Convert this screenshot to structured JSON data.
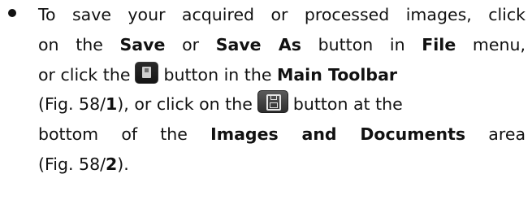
{
  "instruction": {
    "l1_a": "To save your acquired or processed images, click",
    "l2_a": "on the ",
    "l2_save": "Save",
    "l2_b": " or ",
    "l2_save_as": "Save As",
    "l2_c": " button in ",
    "l2_file": "File",
    "l2_d": " menu,",
    "l3_a": "or click the",
    "l3_b": "button in the ",
    "l3_main_toolbar": "Main Toolbar",
    "l4_a": "(Fig. 58/",
    "l4_ref1": "1",
    "l4_b": "), or click on the",
    "l4_c": "button at the",
    "l5_a": "bottom of the ",
    "l5_area": "Images and Documents",
    "l5_b": " area",
    "l6_a": "(Fig. 58/",
    "l6_ref2": "2",
    "l6_b": ")."
  },
  "icons": {
    "main_toolbar_save": "save-icon",
    "images_documents_save": "floppy-disk-icon"
  }
}
